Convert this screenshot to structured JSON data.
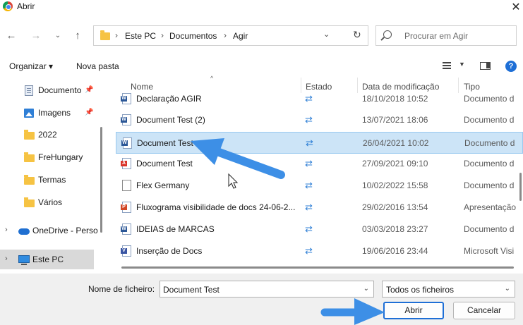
{
  "window": {
    "title": "Abrir"
  },
  "address": {
    "segments": [
      "Este PC",
      "Documentos",
      "Agir"
    ],
    "separator": "›"
  },
  "search": {
    "placeholder": "Procurar em Agir"
  },
  "toolbar": {
    "organize_label": "Organizar ▾",
    "new_folder_label": "Nova pasta",
    "help": "?"
  },
  "nav": {
    "items": [
      {
        "label": "Documento",
        "icon": "document-icon",
        "pinned": true
      },
      {
        "label": "Imagens",
        "icon": "pictures-icon",
        "pinned": true
      },
      {
        "label": "2022",
        "icon": "folder-icon"
      },
      {
        "label": "FreHungary",
        "icon": "folder-icon"
      },
      {
        "label": "Termas",
        "icon": "folder-icon"
      },
      {
        "label": "Vários",
        "icon": "folder-icon"
      },
      {
        "label": "OneDrive - Perso",
        "icon": "onedrive-icon"
      },
      {
        "label": "Este PC",
        "icon": "computer-icon",
        "selected": true
      }
    ]
  },
  "columns": {
    "name": "Nome",
    "status": "Estado",
    "modified": "Data de modificação",
    "type": "Tipo"
  },
  "files": [
    {
      "name": "Declaração AGIR",
      "date": "18/10/2018 10:52",
      "type": "Documento d",
      "kind": "word"
    },
    {
      "name": "Document Test (2)",
      "date": "13/07/2021 18:06",
      "type": "Documento d",
      "kind": "word"
    },
    {
      "name": "Document Test",
      "date": "26/04/2021 10:02",
      "type": "Documento d",
      "kind": "word",
      "selected": true
    },
    {
      "name": "Document Test",
      "date": "27/09/2021 09:10",
      "type": "Documento d",
      "kind": "pdf"
    },
    {
      "name": "Flex Germany",
      "date": "10/02/2022 15:58",
      "type": "Documento d",
      "kind": "generic"
    },
    {
      "name": "Fluxograma visibilidade de docs 24-06-2...",
      "date": "29/02/2016 13:54",
      "type": "Apresentação",
      "kind": "ppt"
    },
    {
      "name": "IDEIAS de MARCAS",
      "date": "03/03/2018 23:27",
      "type": "Documento d",
      "kind": "word"
    },
    {
      "name": "Inserção de Docs",
      "date": "19/06/2016 23:44",
      "type": "Microsoft Visi",
      "kind": "visio"
    }
  ],
  "footer": {
    "filename_label": "Nome de ficheiro:",
    "filename_value": "Document Test",
    "filetype_value": "Todos os ficheiros",
    "open_label": "Abrir",
    "cancel_label": "Cancelar"
  },
  "colors": {
    "accent": "#1e6fd6",
    "selection": "#cce4f7",
    "annotation_arrow": "#3d8fe6"
  }
}
